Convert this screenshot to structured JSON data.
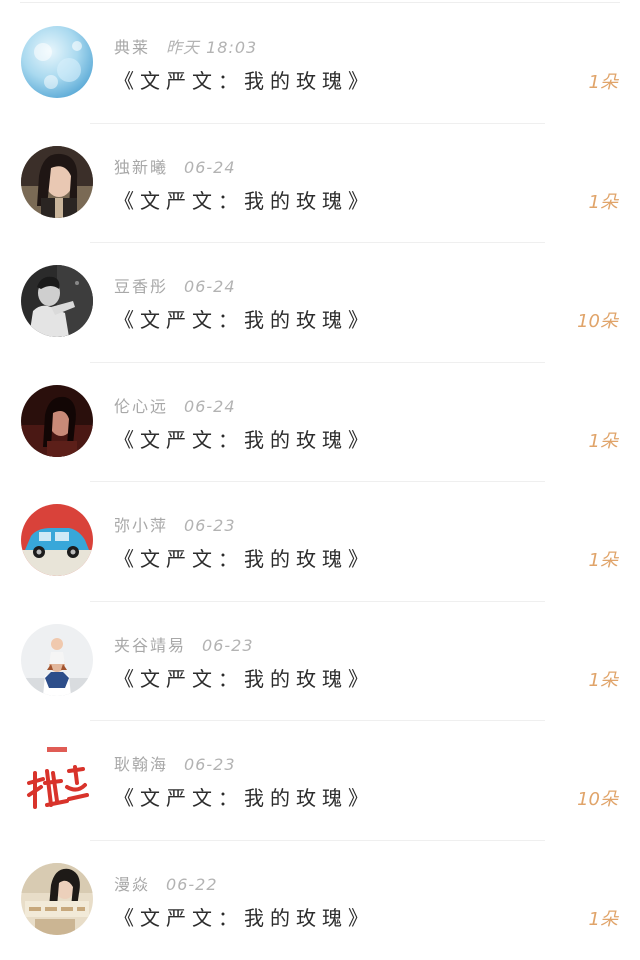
{
  "colors": {
    "accent_count": "#e0a46a",
    "name_text": "#a8a8a8",
    "title_text": "#2c2c2c",
    "divider": "#efefef"
  },
  "items": [
    {
      "name": "典莱",
      "date": "昨天 18:03",
      "title": "《文严文：我的玫瑰》",
      "count": "1朵",
      "avatar_icon": "blue-water-avatar"
    },
    {
      "name": "独新曦",
      "date": "06-24",
      "title": "《文严文：我的玫瑰》",
      "count": "1朵",
      "avatar_icon": "girl-portrait-avatar"
    },
    {
      "name": "豆香彤",
      "date": "06-24",
      "title": "《文严文：我的玫瑰》",
      "count": "10朵",
      "avatar_icon": "bw-portrait-avatar"
    },
    {
      "name": "伦心远",
      "date": "06-24",
      "title": "《文严文：我的玫瑰》",
      "count": "1朵",
      "avatar_icon": "dark-red-portrait-avatar"
    },
    {
      "name": "弥小萍",
      "date": "06-23",
      "title": "《文严文：我的玫瑰》",
      "count": "1朵",
      "avatar_icon": "blue-car-avatar"
    },
    {
      "name": "夹谷靖易",
      "date": "06-23",
      "title": "《文严文：我的玫瑰》",
      "count": "1朵",
      "avatar_icon": "father-child-avatar"
    },
    {
      "name": "耿翰海",
      "date": "06-23",
      "title": "《文严文：我的玫瑰》",
      "count": "10朵",
      "avatar_icon": "red-calligraphy-avatar"
    },
    {
      "name": "漫焱",
      "date": "06-22",
      "title": "《文严文：我的玫瑰》",
      "count": "1朵",
      "avatar_icon": "girl-text-avatar"
    }
  ]
}
